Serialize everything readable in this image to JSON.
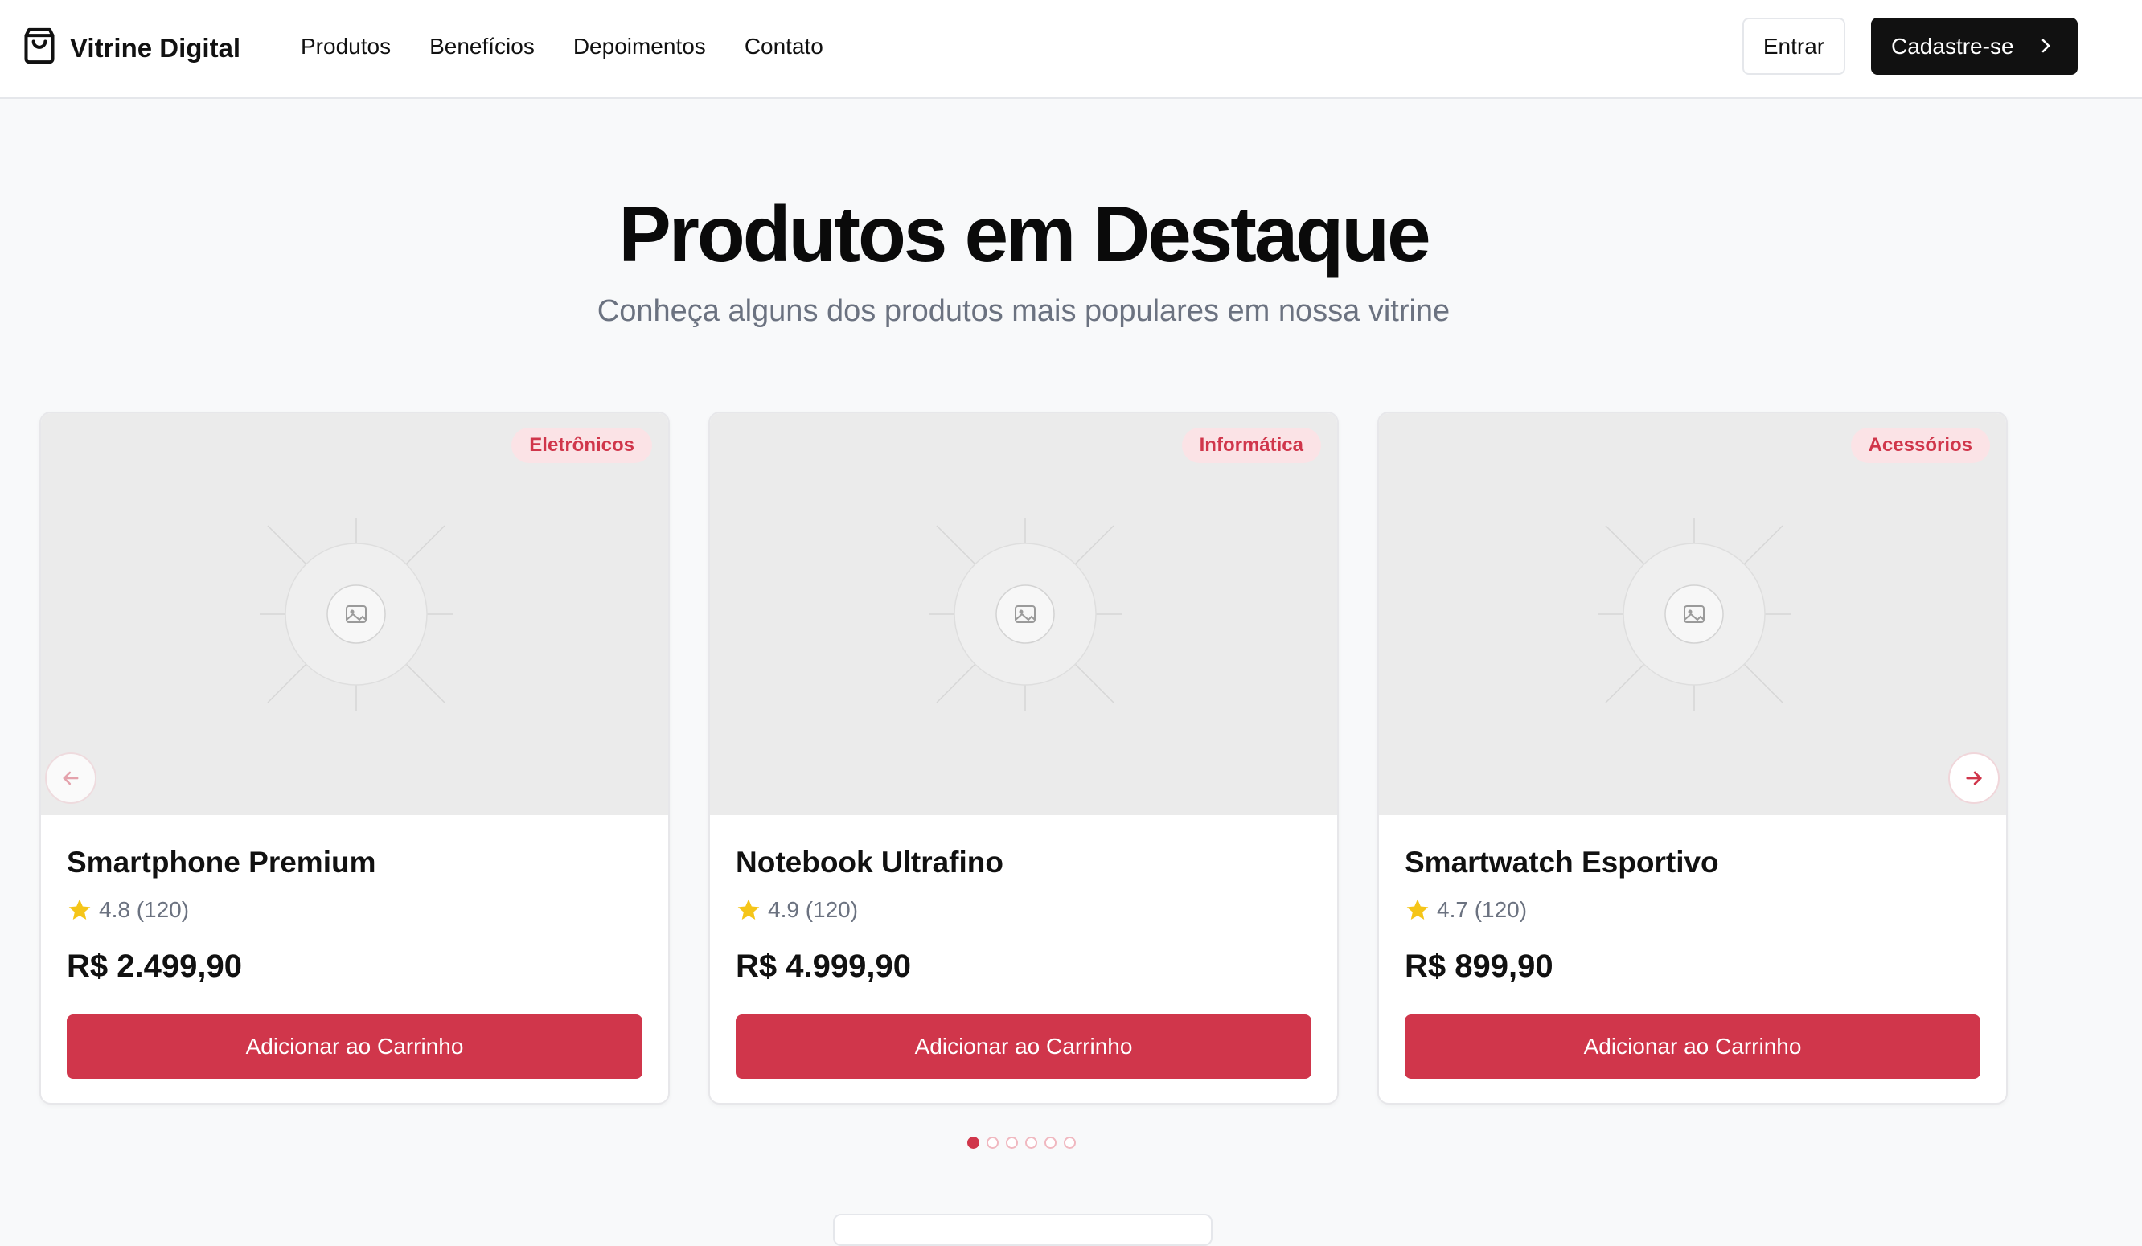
{
  "brand": {
    "name": "Vitrine Digital",
    "icon": "shopping-bag-icon"
  },
  "nav": [
    {
      "label": "Produtos"
    },
    {
      "label": "Benefícios"
    },
    {
      "label": "Depoimentos"
    },
    {
      "label": "Contato"
    }
  ],
  "auth": {
    "login_label": "Entrar",
    "signup_label": "Cadastre-se"
  },
  "hero": {
    "title": "Produtos em Destaque",
    "subtitle": "Conheça alguns dos produtos mais populares em nossa vitrine"
  },
  "products": [
    {
      "category": "Eletrônicos",
      "name": "Smartphone Premium",
      "rating": "4.8 (120)",
      "price": "R$ 2.499,90",
      "cta": "Adicionar ao Carrinho"
    },
    {
      "category": "Informática",
      "name": "Notebook Ultrafino",
      "rating": "4.9 (120)",
      "price": "R$ 4.999,90",
      "cta": "Adicionar ao Carrinho"
    },
    {
      "category": "Acessórios",
      "name": "Smartwatch Esportivo",
      "rating": "4.7 (120)",
      "price": "R$ 899,90",
      "cta": "Adicionar ao Carrinho"
    }
  ],
  "carousel": {
    "total_pages": 6,
    "active_page": 1
  },
  "colors": {
    "accent": "#d0364b",
    "badge_bg": "#fbe3e6",
    "star": "#f5c518",
    "dark": "#111111"
  }
}
